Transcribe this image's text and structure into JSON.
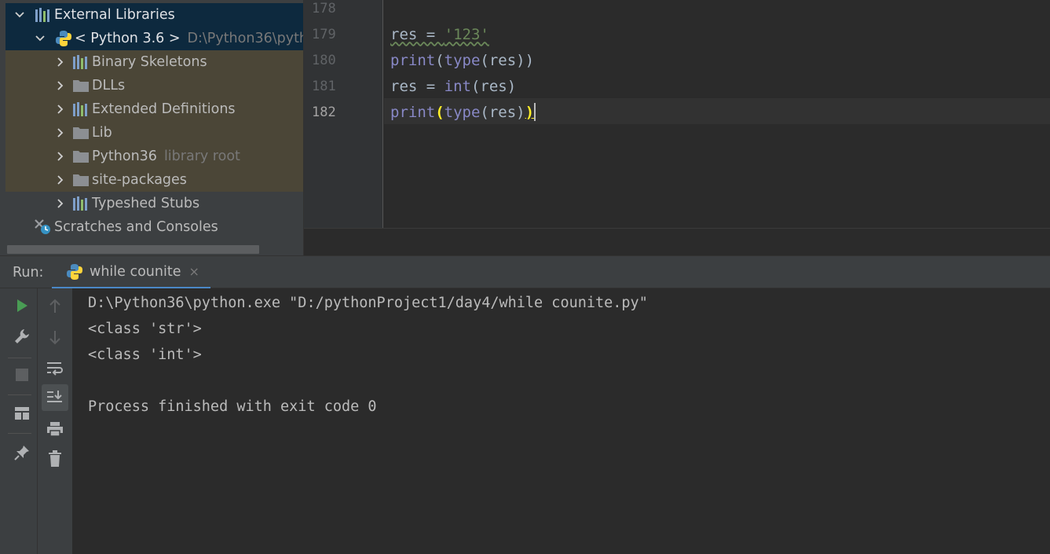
{
  "project_tree": {
    "items": [
      {
        "label": "External Libraries",
        "icon": "library-icon",
        "expanded": true
      },
      {
        "label": "< Python 3.6 >",
        "hint": "D:\\Python36\\pyth",
        "icon": "python-icon",
        "expanded": true
      },
      {
        "label": "Binary Skeletons",
        "icon": "library-icon"
      },
      {
        "label": "DLLs",
        "icon": "folder-icon"
      },
      {
        "label": "Extended Definitions",
        "icon": "library-icon"
      },
      {
        "label": "Lib",
        "icon": "folder-icon"
      },
      {
        "label": "Python36",
        "hint": "library root",
        "icon": "folder-icon"
      },
      {
        "label": "site-packages",
        "icon": "folder-icon"
      },
      {
        "label": "Typeshed Stubs",
        "icon": "library-icon"
      },
      {
        "label": "Scratches and Consoles",
        "icon": "scratches-icon"
      }
    ]
  },
  "editor": {
    "line_numbers": [
      "178",
      "179",
      "180",
      "181",
      "182"
    ],
    "lines": [
      "",
      "res = '123'",
      "print(type(res))",
      "res = int(res)",
      "print(type(res))"
    ]
  },
  "run": {
    "title": "Run:",
    "tab_label": "while counite",
    "close_glyph": "×",
    "output": [
      "D:\\Python36\\python.exe \"D:/pythonProject1/day4/while counite.py\"",
      "<class 'str'>",
      "<class 'int'>",
      "",
      "Process finished with exit code 0"
    ]
  },
  "colors": {
    "background": "#2b2b2b",
    "panel": "#3c3f41",
    "selection": "#0d293e",
    "library_highlight": "#4b4637",
    "keyword": "#8888c6",
    "string": "#6a8759",
    "brace_match": "#ffef28",
    "run_green": "#499c54"
  }
}
